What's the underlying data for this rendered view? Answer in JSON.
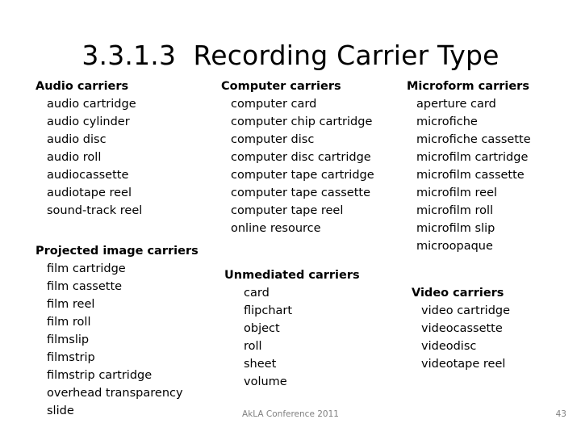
{
  "slide": {
    "title": "3.3.1.3  Recording Carrier Type",
    "columns": [
      {
        "id": "column-1",
        "groups": [
          {
            "id": "audio-carriers",
            "heading": "Audio carriers",
            "items": [
              "audio cartridge",
              "audio cylinder",
              "audio disc",
              "audio roll",
              "audiocassette",
              "audiotape reel",
              "sound-track reel"
            ]
          },
          {
            "id": "projected-image-carriers",
            "heading": "Projected image carriers",
            "items": [
              "film cartridge",
              "film cassette",
              "film reel",
              "film roll",
              "filmslip",
              "filmstrip",
              "filmstrip cartridge",
              "overhead transparency",
              "slide"
            ]
          }
        ]
      },
      {
        "id": "column-2",
        "groups": [
          {
            "id": "computer-carriers",
            "heading": "Computer carriers",
            "items": [
              "computer card",
              "computer chip cartridge",
              "computer disc",
              "computer disc cartridge",
              "computer tape cartridge",
              "computer tape cassette",
              "computer tape reel",
              "online resource"
            ]
          },
          {
            "id": "unmediated-carriers",
            "heading": "Unmediated carriers",
            "items": [
              "card",
              "flipchart",
              "object",
              "roll",
              "sheet",
              "volume"
            ]
          }
        ]
      },
      {
        "id": "column-3",
        "groups": [
          {
            "id": "microform-carriers",
            "heading": "Microform carriers",
            "items": [
              "aperture card",
              "microfiche",
              "microfiche cassette",
              "microfilm cartridge",
              "microfilm cassette",
              "microfilm reel",
              "microfilm roll",
              "microfilm slip",
              "microopaque"
            ]
          },
          {
            "id": "video-carriers",
            "heading": "Video carriers",
            "items": [
              "video cartridge",
              "videocassette",
              "videodisc",
              "videotape reel"
            ]
          }
        ]
      }
    ],
    "footer": {
      "text": "AkLA Conference 2011",
      "page_number": "43",
      "color": "#808080"
    }
  }
}
